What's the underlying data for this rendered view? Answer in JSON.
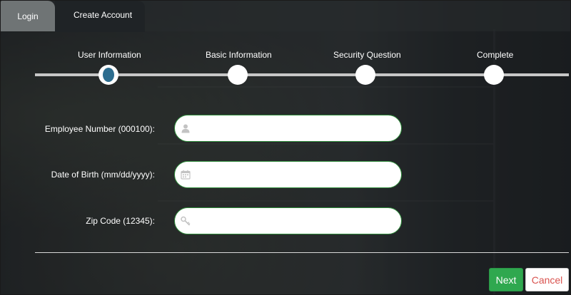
{
  "tabs": {
    "login": "Login",
    "create_account": "Create Account"
  },
  "stepper": {
    "steps": [
      "User Information",
      "Basic Information",
      "Security Question",
      "Complete"
    ],
    "active_index": 0,
    "active_color": "#2d6d8f"
  },
  "form": {
    "employee_number": {
      "label": "Employee Number (000100):",
      "value": "",
      "icon": "user-icon"
    },
    "date_of_birth": {
      "label": "Date of Birth (mm/dd/yyyy):",
      "value": "",
      "icon": "calendar-icon"
    },
    "zip_code": {
      "label": "Zip Code (12345):",
      "value": "",
      "icon": "key-icon"
    }
  },
  "buttons": {
    "next": "Next",
    "cancel": "Cancel"
  },
  "colors": {
    "next_button": "#2fa84f",
    "cancel_text": "#d9534f",
    "field_border": "#2e8b3a"
  }
}
